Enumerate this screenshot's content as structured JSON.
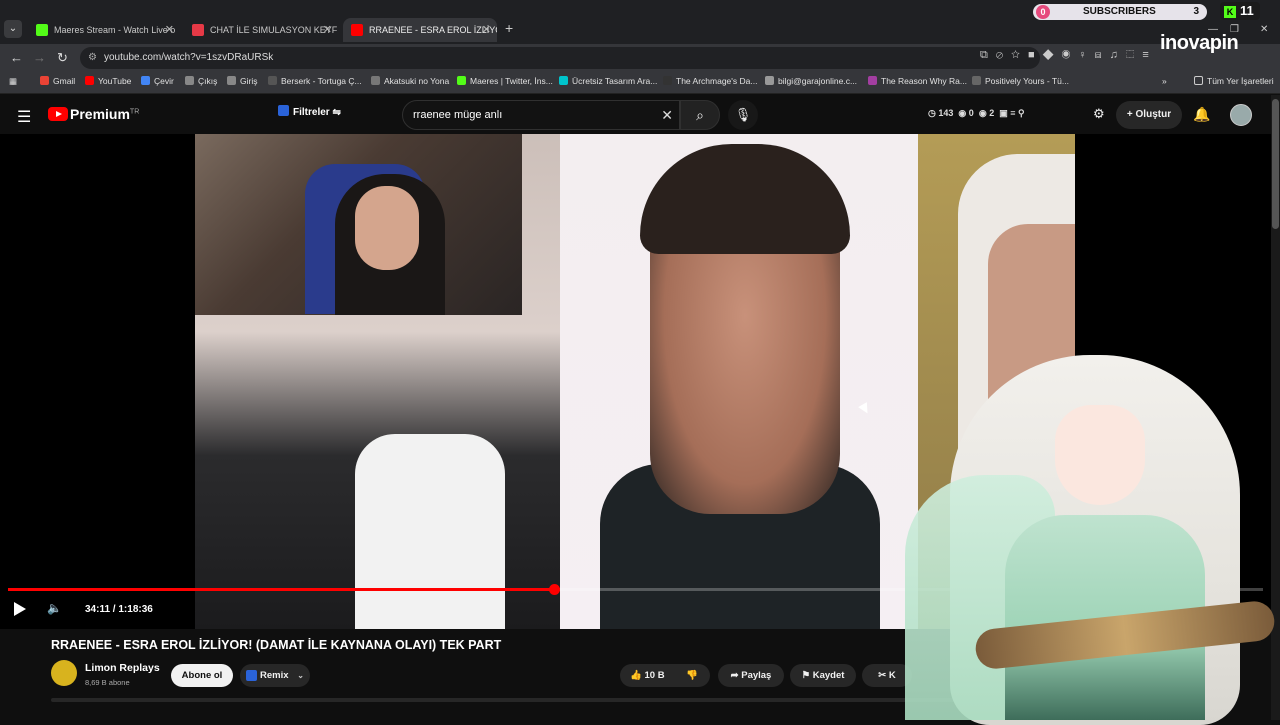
{
  "browser": {
    "tabs": [
      {
        "title": "Maeres Stream - Watch Live o",
        "color": "#53fc18"
      },
      {
        "title": "CHAT İLE SIMULASYON KEYFİ |",
        "color": "#e63946"
      },
      {
        "title": "RRAENEE - ESRA EROL İZLİYOR",
        "color": "#ff0000"
      }
    ],
    "url": "youtube.com/watch?v=1szvDRaURSk",
    "bookmarks": [
      {
        "label": "Gmail",
        "color": "#ea4335"
      },
      {
        "label": "YouTube",
        "color": "#ff0000"
      },
      {
        "label": "Çevir",
        "color": "#4285f4"
      },
      {
        "label": "Çıkış",
        "color": "#888888"
      },
      {
        "label": "Giriş",
        "color": "#888888"
      },
      {
        "label": "Berserk - Tortuga Ç...",
        "color": "#555555"
      },
      {
        "label": "Akatsuki no Yona",
        "color": "#777777"
      },
      {
        "label": "Maeres | Twitter, İns...",
        "color": "#53fc18"
      },
      {
        "label": "Ücretsiz Tasarım Ara...",
        "color": "#00c4cc"
      },
      {
        "label": "The Archmage's Da...",
        "color": "#333333"
      },
      {
        "label": "bilgi@garajonline.c...",
        "color": "#999999"
      },
      {
        "label": "The Reason Why Ra...",
        "color": "#a33ea1"
      },
      {
        "label": "Positively Yours - Tü...",
        "color": "#666666"
      }
    ],
    "all_bookmarks": "Tüm Yer İşaretleri"
  },
  "overlay": {
    "subscribers_label": "SUBSCRIBERS",
    "subscribers_left": "0",
    "subscribers_right": "3",
    "kick_count": "11",
    "brand": "inovapin"
  },
  "youtube": {
    "logo_text": "Premium",
    "logo_sup": "TR",
    "filters_label": "Filtreler",
    "search_value": "rraenee müge anlı",
    "stats": {
      "a": "143",
      "b": "0",
      "c": "2"
    },
    "create_label": "Oluştur"
  },
  "player": {
    "time": "34:11 / 1:18:36",
    "progress": 0.435
  },
  "video": {
    "title": "RRAENEE - ESRA EROL İZLİYOR! (DAMAT İLE KAYNANA OLAYI) TEK PART",
    "channel_name": "Limon Replays",
    "channel_subs": "8,69 B abone",
    "subscribe_label": "Abone ol",
    "remix_label": "Remix",
    "likes": "10 B",
    "share_label": "Paylaş",
    "save_label": "Kaydet",
    "clip_label": "K"
  }
}
